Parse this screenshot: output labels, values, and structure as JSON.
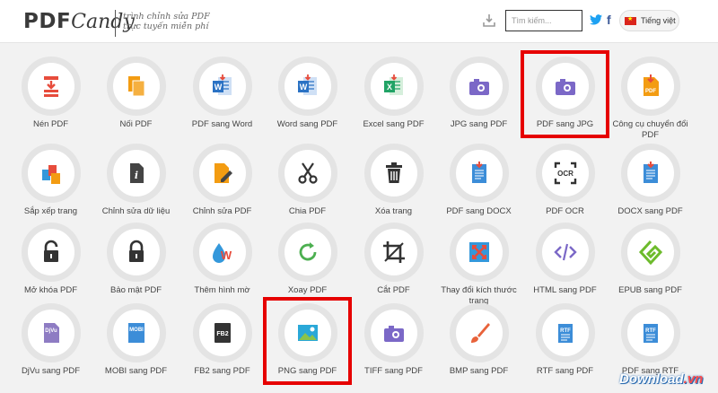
{
  "header": {
    "logo_pdf": "PDF",
    "logo_candy": "Candy",
    "tagline_line1": "trình chỉnh sửa PDF",
    "tagline_line2": "trực tuyến miễn phí",
    "search_placeholder": "Tìm kiếm...",
    "language": "Tiếng việt"
  },
  "tools": [
    {
      "label": "Nén PDF",
      "icon": "compress-icon"
    },
    {
      "label": "Nối PDF",
      "icon": "merge-icon"
    },
    {
      "label": "PDF sang Word",
      "icon": "word-icon"
    },
    {
      "label": "Word sang PDF",
      "icon": "word-icon"
    },
    {
      "label": "Excel sang PDF",
      "icon": "excel-icon"
    },
    {
      "label": "JPG sang PDF",
      "icon": "camera-icon"
    },
    {
      "label": "PDF sang JPG",
      "icon": "camera-icon"
    },
    {
      "label": "Công cụ chuyển đổi PDF",
      "icon": "pdf-file-icon"
    },
    {
      "label": "Sắp xếp trang",
      "icon": "sort-pages-icon"
    },
    {
      "label": "Chỉnh sửa dữ liệu",
      "icon": "info-file-icon"
    },
    {
      "label": "Chỉnh sửa PDF",
      "icon": "edit-pencil-icon"
    },
    {
      "label": "Chia PDF",
      "icon": "scissors-icon"
    },
    {
      "label": "Xóa trang",
      "icon": "trash-icon"
    },
    {
      "label": "PDF sang DOCX",
      "icon": "docx-icon"
    },
    {
      "label": "PDF OCR",
      "icon": "ocr-icon"
    },
    {
      "label": "DOCX sang PDF",
      "icon": "docx-icon"
    },
    {
      "label": "Mở khóa PDF",
      "icon": "unlock-icon"
    },
    {
      "label": "Bảo mật PDF",
      "icon": "lock-icon"
    },
    {
      "label": "Thêm hình mờ",
      "icon": "watermark-drop-icon"
    },
    {
      "label": "Xoay PDF",
      "icon": "rotate-icon"
    },
    {
      "label": "Cắt PDF",
      "icon": "crop-icon"
    },
    {
      "label": "Thay đổi kích thước trang",
      "icon": "resize-arrows-icon"
    },
    {
      "label": "HTML sang PDF",
      "icon": "code-icon"
    },
    {
      "label": "EPUB sang PDF",
      "icon": "epub-icon"
    },
    {
      "label": "DjVu sang PDF",
      "icon": "djvu-icon"
    },
    {
      "label": "MOBI sang PDF",
      "icon": "mobi-icon"
    },
    {
      "label": "FB2 sang PDF",
      "icon": "fb2-icon"
    },
    {
      "label": "PNG sang PDF",
      "icon": "image-icon"
    },
    {
      "label": "TIFF sang PDF",
      "icon": "camera-icon"
    },
    {
      "label": "BMP sang PDF",
      "icon": "brush-icon"
    },
    {
      "label": "RTF sang PDF",
      "icon": "rtf-icon"
    },
    {
      "label": "PDF sang RTF",
      "icon": "rtf-icon"
    }
  ],
  "highlighted_tools": [
    "PDF sang JPG",
    "PNG sang PDF"
  ],
  "highlight_color": "#e60000",
  "watermark": {
    "text": "Download",
    "suffix": ".vn"
  }
}
